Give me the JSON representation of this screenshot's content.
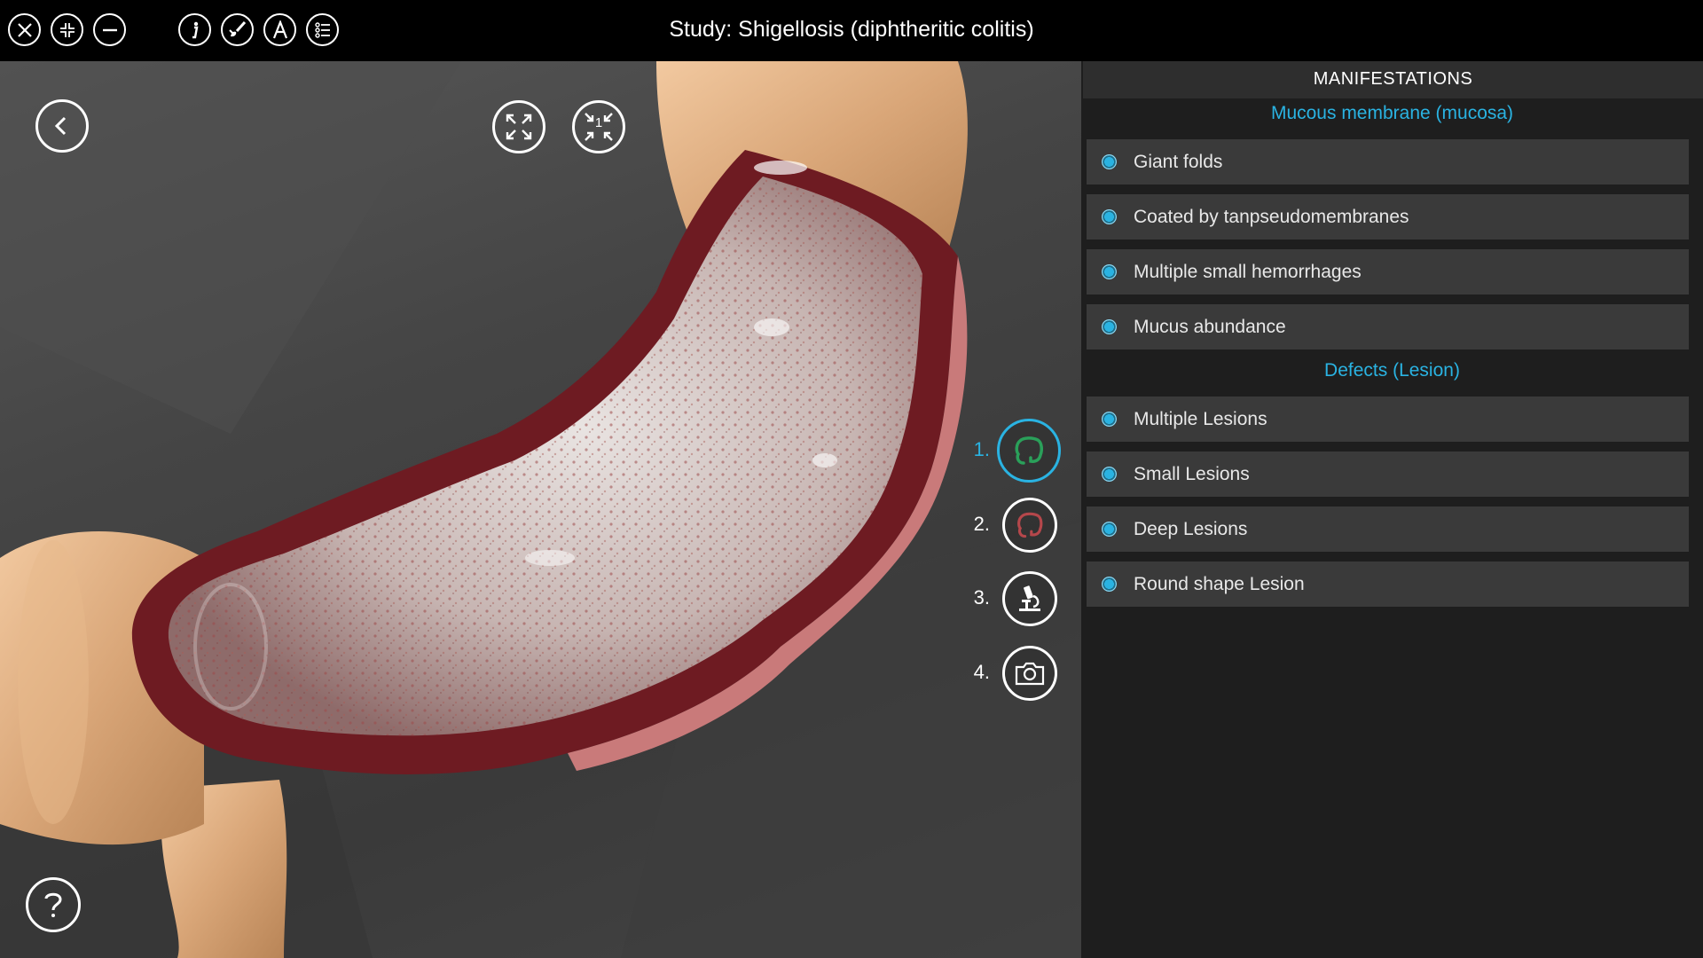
{
  "topbar": {
    "title": "Study: Shigellosis (diphtheritic colitis)",
    "icons": [
      "close-icon",
      "collapse-icon",
      "minimize-icon",
      "info-icon",
      "brush-icon",
      "annotation-icon",
      "list-icon"
    ]
  },
  "viewport": {
    "back_icon": "chevron-left-icon",
    "fullscreen_icon": "expand-icon",
    "reset_view_icon": "reset-view-icon",
    "reset_view_badge": "1",
    "help_icon": "question-icon",
    "views": [
      {
        "num": "1.",
        "icon": "colon-icon",
        "active": true
      },
      {
        "num": "2.",
        "icon": "colon-icon"
      },
      {
        "num": "3.",
        "icon": "microscope-icon"
      },
      {
        "num": "4.",
        "icon": "camera-icon"
      }
    ]
  },
  "panel": {
    "header": "MANIFESTATIONS",
    "sections": [
      {
        "title": "Mucous membrane (mucosa)",
        "items": [
          "Giant folds",
          "Coated by tanpseudomembranes",
          "Multiple small hemorrhages",
          "Mucus abundance"
        ]
      },
      {
        "title": "Defects (Lesion)",
        "items": [
          "Multiple Lesions",
          "Small Lesions",
          "Deep Lesions",
          "Round shape Lesion"
        ]
      }
    ]
  },
  "colors": {
    "accent": "#2ab3e2",
    "panel_bg": "#1e1e1e",
    "item_bg": "#3a3a3a"
  }
}
